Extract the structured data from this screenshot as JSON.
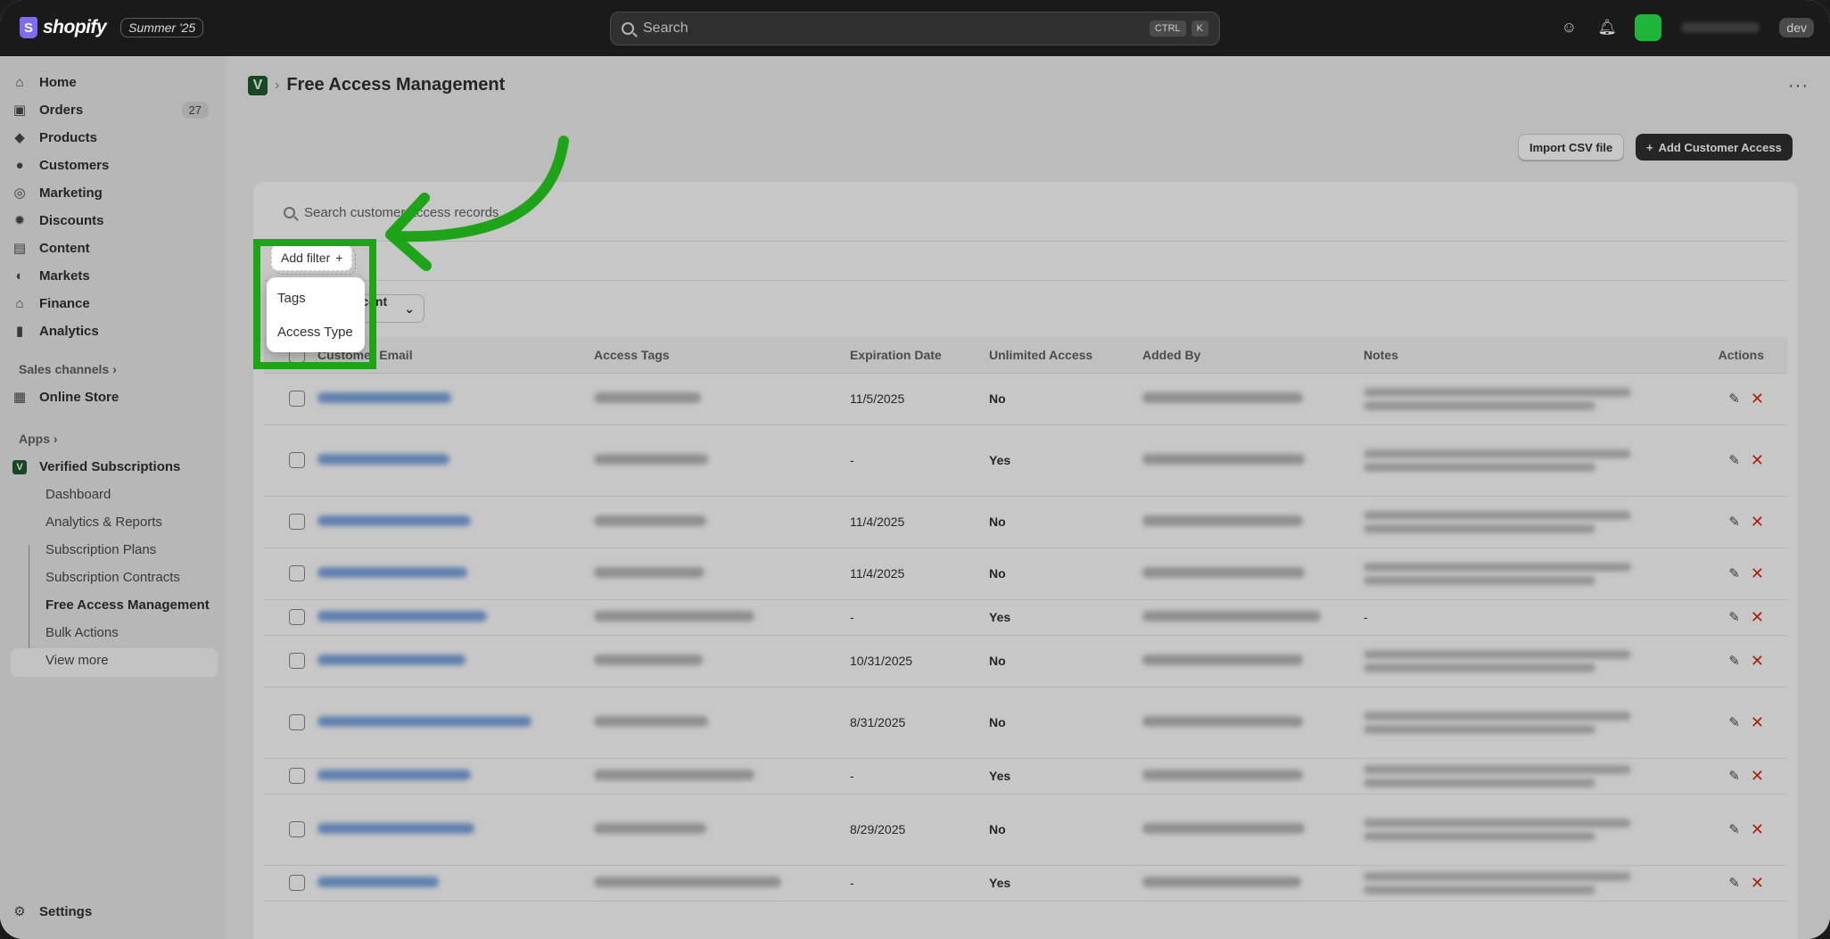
{
  "topbar": {
    "logo_text": "shopify",
    "season_badge": "Summer '25",
    "search_placeholder": "Search",
    "shortcut_ctrl": "CTRL",
    "shortcut_k": "K",
    "dev_badge": "dev"
  },
  "sidebar": {
    "items": [
      {
        "label": "Home",
        "icon": "home-icon"
      },
      {
        "label": "Orders",
        "icon": "orders-icon",
        "count": "27"
      },
      {
        "label": "Products",
        "icon": "tag-icon"
      },
      {
        "label": "Customers",
        "icon": "person-icon"
      },
      {
        "label": "Marketing",
        "icon": "target-icon"
      },
      {
        "label": "Discounts",
        "icon": "discount-icon"
      },
      {
        "label": "Content",
        "icon": "content-icon"
      },
      {
        "label": "Markets",
        "icon": "globe-icon"
      },
      {
        "label": "Finance",
        "icon": "bank-icon"
      },
      {
        "label": "Analytics",
        "icon": "bar-chart-icon"
      }
    ],
    "sales_channels_label": "Sales channels",
    "online_store_label": "Online Store",
    "apps_label": "Apps",
    "app_name": "Verified Subscriptions",
    "app_sub_items": [
      "Dashboard",
      "Analytics & Reports",
      "Subscription Plans",
      "Subscription Contracts",
      "Free Access Management",
      "Bulk Actions",
      "View more"
    ],
    "settings_label": "Settings"
  },
  "page": {
    "app_icon_letter": "V",
    "title": "Free Access Management",
    "more": "···",
    "import_button": "Import CSV file",
    "add_button": "Add Customer Access"
  },
  "card": {
    "search_placeholder": "Search customer access records",
    "add_filter_label": "Add filter",
    "sort_label": "Sort: Most recent first"
  },
  "table": {
    "headers": [
      "Customer Email",
      "Access Tags",
      "Expiration Date",
      "Unlimited Access",
      "Added By",
      "Notes",
      "Actions"
    ],
    "rows": [
      {
        "expiration": "11/5/2025",
        "unlimited": "No",
        "notes": ""
      },
      {
        "expiration": "-",
        "unlimited": "Yes",
        "notes": ""
      },
      {
        "expiration": "11/4/2025",
        "unlimited": "No",
        "notes": ""
      },
      {
        "expiration": "11/4/2025",
        "unlimited": "No",
        "notes": ""
      },
      {
        "expiration": "-",
        "unlimited": "Yes",
        "notes": "-"
      },
      {
        "expiration": "10/31/2025",
        "unlimited": "No",
        "notes": ""
      },
      {
        "expiration": "8/31/2025",
        "unlimited": "No",
        "notes": ""
      },
      {
        "expiration": "-",
        "unlimited": "Yes",
        "notes": ""
      },
      {
        "expiration": "8/29/2025",
        "unlimited": "No",
        "notes": ""
      },
      {
        "expiration": "-",
        "unlimited": "Yes",
        "notes": ""
      }
    ]
  },
  "popover": {
    "items": [
      "Tags",
      "Access Type"
    ]
  },
  "colors": {
    "highlight": "#1fa319",
    "delete": "#d72c0d",
    "primary": "#303030"
  }
}
